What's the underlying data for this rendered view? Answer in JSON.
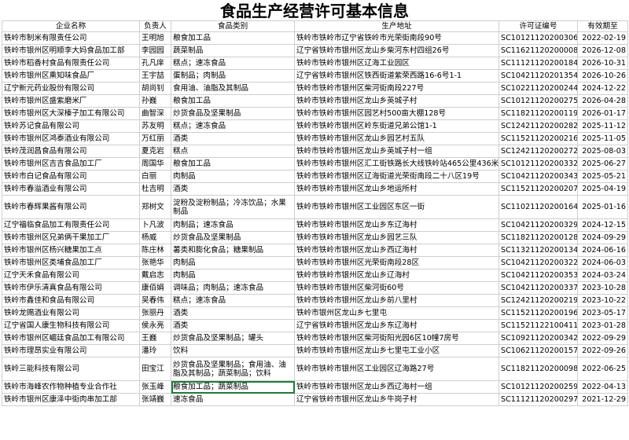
{
  "title": "食品生产经营许可基本信息",
  "columns": [
    "企业名称",
    "负责人",
    "食品类别",
    "生产地址",
    "许可证编号",
    "有效期至"
  ],
  "rows": [
    {
      "name": "铁岭市制米有限责任公司",
      "person": "王明旭",
      "category": "粮食加工品",
      "address": "铁岭市铁岭市辽宁省铁岭市光荣街南段90号",
      "license": "SC10121120200306",
      "expiry": "2022-02-19"
    },
    {
      "name": "铁岭市银州区明顺李大妈食品加工部",
      "person": "李园园",
      "category": "蔬菜制品",
      "address": "辽宁省铁岭市银州区龙山乡柴河东村四组26号",
      "license": "SC11621120200008",
      "expiry": "2026-12-08"
    },
    {
      "name": "铁岭市稻香村食品有限责任公司",
      "person": "孔凡庠",
      "category": "糕点；速冻食品",
      "address": "铁岭市铁岭市银州区辽海工业园区",
      "license": "SC11121120200184",
      "expiry": "2026-10-31"
    },
    {
      "name": "铁岭市银州区熏知味食品厂",
      "person": "王宇喆",
      "category": "蛋制品；肉制品",
      "address": "辽宁省铁岭市银州区铁西街道紫荣西路16-6号1-1",
      "license": "SC10421120201354",
      "expiry": "2026-10-26"
    },
    {
      "name": "辽宁新元药业股份有限公司",
      "person": "胡尚钊",
      "category": "食用油、油脂及其制品",
      "address": "铁岭市铁岭市银州区柴河街南段227号",
      "license": "SC10221120200244",
      "expiry": "2024-12-22"
    },
    {
      "name": "铁岭市银州区盛紫磨米厂",
      "person": "孙巍",
      "category": "粮食加工品",
      "address": "铁岭市铁岭市银州区龙山乡英城子村",
      "license": "SC10121120200275",
      "expiry": "2026-04-28"
    },
    {
      "name": "铁岭市银州区大深榛子加工有限公司",
      "person": "曲智深",
      "category": "炒货食品及坚果制品",
      "address": "铁岭市铁岭市银州区园艺村500亩大棚128号",
      "license": "SC11821120200119",
      "expiry": "2026-01-17"
    },
    {
      "name": "铁岭苏记食品有限公司",
      "person": "苏友明",
      "category": "糕点；速冻食品",
      "address": "铁岭市铁岭市银州区岭东街道兄弟公馆1-1",
      "license": "SC12421120200282",
      "expiry": "2025-11-12"
    },
    {
      "name": "铁岭市银州区鸿泰酒业有限公司",
      "person": "万红丽",
      "category": "酒类",
      "address": "铁岭市铁岭市银州区龙山乡园艺村五队",
      "license": "SC11521120200216",
      "expiry": "2025-11-05"
    },
    {
      "name": "铁岭茂润昌食品有限公司",
      "person": "夏克岩",
      "category": "糕点",
      "address": "铁岭市铁岭市银州区龙山乡英城子村一组",
      "license": "SC12421120200272",
      "expiry": "2025-08-03"
    },
    {
      "name": "铁岭市银州区吉吉食品加工厂",
      "person": "周国华",
      "category": "粮食加工品",
      "address": "铁岭市铁岭市银州区汇工街铁路长大线铁岭站465公里436米",
      "license": "SC10121120200332",
      "expiry": "2025-06-27"
    },
    {
      "name": "铁岭市白记食品有限公司",
      "person": "白丽",
      "category": "肉制品",
      "address": "铁岭市铁岭市银州区辽海街道光荣街南段二十八区19号",
      "license": "SC10421120200343",
      "expiry": "2025-05-21"
    },
    {
      "name": "铁岭市春溢酒业有限公司",
      "person": "杜吉明",
      "category": "酒类",
      "address": "铁岭市铁岭市银州区龙山乡地运所村",
      "license": "SC11521120200207",
      "expiry": "2025-04-19"
    },
    {
      "name": "铁岭市春辉果酱有限公司",
      "person": "郑树文",
      "category": "淀粉及淀粉制品；冷冻饮品；水果制品",
      "address": "铁岭市铁岭市银州区工业园区东区一街",
      "license": "SC11021120200164",
      "expiry": "2025-01-16",
      "tall": true
    },
    {
      "name": "辽宁福临食品加工有限责任公司",
      "person": "卜凡波",
      "category": "肉制品；速冻食品",
      "address": "铁岭市铁岭市银州区龙山乡东辽海村",
      "license": "SC10421120200329",
      "expiry": "2024-12-15"
    },
    {
      "name": "铁岭市银州区兄弟俩干果加工厂",
      "person": "杨威",
      "category": "炒货食品及坚果制品",
      "address": "铁岭市铁岭市银州区龙山乡园艺三队",
      "license": "SC11821120200128",
      "expiry": "2024-09-29"
    },
    {
      "name": "铁岭市银州区杨兴糖果加工点",
      "person": "陈庄林",
      "category": "薯类和膨化食品；糖果制品",
      "address": "铁岭市铁岭市银州区龙山乡西辽海村",
      "license": "SC11321120200134",
      "expiry": "2024-06-16"
    },
    {
      "name": "铁岭市银州区类埔食品加工厂",
      "person": "张艳华",
      "category": "肉制品",
      "address": "铁岭市铁岭市银州区光荣街南段28区",
      "license": "SC10421120200322",
      "expiry": "2024-06-03"
    },
    {
      "name": "辽宁天禾食品有限公司",
      "person": "戴启志",
      "category": "肉制品",
      "address": "铁岭市铁岭市银州区龙山乡辽海村",
      "license": "SC10421120200353",
      "expiry": "2024-03-24"
    },
    {
      "name": "铁岭市伊乐清真食品有限公司",
      "person": "康佰娟",
      "category": "调味品；肉制品；速冻食品",
      "address": "铁岭市铁岭市银州区柴河街60号",
      "license": "SC10421120200337",
      "expiry": "2023-10-28"
    },
    {
      "name": "铁岭市鑫佳和食品有限公司",
      "person": "吴春伟",
      "category": "糕点；速冻食品",
      "address": "铁岭市铁岭市银州区龙山乡前八里村",
      "license": "SC12421120200219",
      "expiry": "2023-10-22"
    },
    {
      "name": "铁岭龙赐酒业有限公司",
      "person": "张丽丹",
      "category": "酒类",
      "address": "铁岭市银州区龙山乡七里屯",
      "license": "SC11521120200196",
      "expiry": "2023-05-17"
    },
    {
      "name": "辽宁省国人康生物科技有限公司",
      "person": "侯永亮",
      "category": "酒类",
      "address": "辽宁省铁岭市银州区龙山乡东辽海村",
      "license": "SC11521122100411",
      "expiry": "2023-01-28"
    },
    {
      "name": "铁岭市银州区嵋廷食品加工有限公司",
      "person": "王巍",
      "category": "炒货食品及坚果制品；罐头",
      "address": "铁岭市铁岭市银州区柴河街阳光园6区10幢7房号",
      "license": "SC10921120200342",
      "expiry": "2022-09-29"
    },
    {
      "name": "铁岭市理昂实业有限公司",
      "person": "潘玲",
      "category": "饮料",
      "address": "铁岭市铁岭市银州区龙山乡七里屯工业小区",
      "license": "SC10621120200157",
      "expiry": "2022-09-26"
    },
    {
      "name": "铁岭三能科技有限公司",
      "person": "田宝江",
      "category": "炒货食品及坚果制品；食用油、油脂及其制品；蔬菜制品；饮料",
      "address": "铁岭市铁岭市银州区工业园区辽海路27号",
      "license": "SC11821120200098",
      "expiry": "2022-06-25",
      "tall": true
    },
    {
      "name": "铁岭市海峰农作物种植专业合作社",
      "person": "张玉峰",
      "category": "粮食加工品；蔬菜制品",
      "address": "铁岭市铁岭市银州区龙山乡西辽海村一组",
      "license": "SC10121120200259",
      "expiry": "2022-04-13",
      "selected": true
    },
    {
      "name": "铁岭市银州区康泽中街肉串加工部",
      "person": "张靖巍",
      "category": "速冻食品",
      "address": "辽宁省铁岭市银州区龙山乡牛岗子村",
      "license": "SC11121120200297",
      "expiry": "2021-12-29"
    }
  ]
}
